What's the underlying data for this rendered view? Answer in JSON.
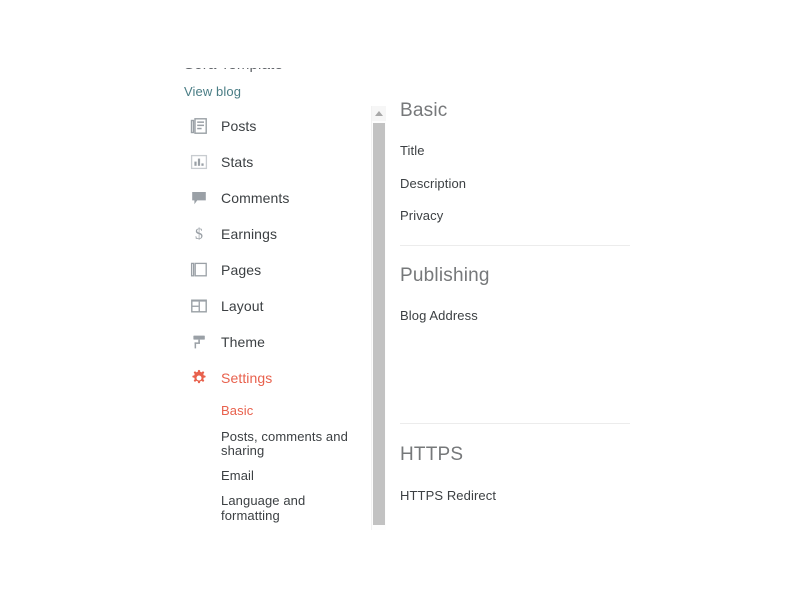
{
  "nav": {
    "blog_title": "Sora Template",
    "view_blog_label": "View blog",
    "items": [
      {
        "label": "Posts",
        "icon": "posts-icon",
        "active": false
      },
      {
        "label": "Stats",
        "icon": "stats-icon",
        "active": false
      },
      {
        "label": "Comments",
        "icon": "comments-icon",
        "active": false
      },
      {
        "label": "Earnings",
        "icon": "earnings-icon",
        "active": false
      },
      {
        "label": "Pages",
        "icon": "pages-icon",
        "active": false
      },
      {
        "label": "Layout",
        "icon": "layout-icon",
        "active": false
      },
      {
        "label": "Theme",
        "icon": "theme-icon",
        "active": false
      },
      {
        "label": "Settings",
        "icon": "settings-gear-icon",
        "active": true
      }
    ],
    "sub_items": [
      {
        "label": "Basic",
        "active": true
      },
      {
        "label": "Posts, comments and sharing",
        "active": false
      },
      {
        "label": "Email",
        "active": false
      },
      {
        "label": "Language and formatting",
        "active": false
      }
    ],
    "scrollbar": {
      "up_arrow_icon": "chevron-up-icon"
    }
  },
  "content": {
    "sections": [
      {
        "title": "Basic",
        "rows": [
          "Title",
          "Description",
          "Privacy"
        ]
      },
      {
        "title": "Publishing",
        "rows": [
          "Blog Address"
        ]
      },
      {
        "title": "HTTPS",
        "rows": [
          "HTTPS Redirect"
        ]
      }
    ]
  },
  "colors": {
    "accent": "#e8614d",
    "link": "#4a7d85",
    "heading": "#76787a",
    "text": "#3c4043",
    "icon": "#9aa0a6",
    "divider": "#ececec",
    "scroll_thumb": "#c2c2c2"
  }
}
